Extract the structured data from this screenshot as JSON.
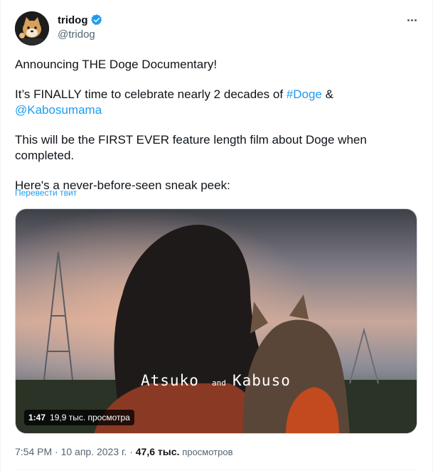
{
  "author": {
    "display_name": "tridog",
    "handle": "@tridog",
    "verified": true,
    "avatar_icon": "shiba-avatar-icon"
  },
  "more_menu_icon": "more-horizontal-icon",
  "tweet": {
    "line1": "Announcing THE Doge Documentary!",
    "line2_prefix": "It’s FINALLY time to celebrate nearly 2 decades of",
    "hashtag": "#Doge",
    "ampersand": "&",
    "mention": "@Kabosumama",
    "line3": "This will be the FIRST EVER feature length film about Doge when completed.",
    "line4": "Here's a never-before-seen sneak peek:"
  },
  "translate_link": "Перевести твит",
  "video": {
    "caption_left": "Atsuko",
    "caption_mid": "and",
    "caption_right": "Kabuso",
    "duration": "1:47",
    "views": "19,9 тыс. просмотра"
  },
  "footer": {
    "time": "7:54 PM",
    "separator": "·",
    "date": "10 апр. 2023 г.",
    "views_count": "47,6 тыс.",
    "views_label": "просмотров"
  },
  "colors": {
    "link": "#1d9bf0",
    "secondary_text": "#536471",
    "primary_text": "#0f1419"
  }
}
